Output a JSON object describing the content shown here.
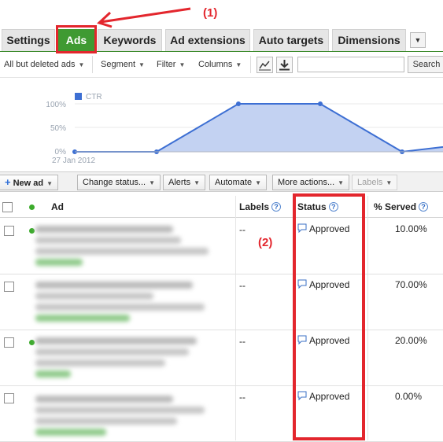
{
  "annotations": {
    "label1": "(1)",
    "label2": "(2)"
  },
  "tabs": [
    "Settings",
    "Ads",
    "Keywords",
    "Ad extensions",
    "Auto targets",
    "Dimensions"
  ],
  "toolbar": {
    "filter_scope": "All but deleted ads",
    "segment": "Segment",
    "filter": "Filter",
    "columns": "Columns",
    "search_value": "",
    "search_label": "Search"
  },
  "chart_data": {
    "type": "area",
    "legend": "CTR",
    "start_label": "27 Jan 2012",
    "yticks": [
      "100%",
      "50%",
      "0%"
    ],
    "ylim": [
      0,
      100
    ],
    "values": [
      0,
      0,
      100,
      100,
      0,
      20
    ],
    "color": "#3d6fd3"
  },
  "actions": {
    "new_ad": "New ad",
    "change_status": "Change status...",
    "alerts": "Alerts",
    "automate": "Automate",
    "more_actions": "More actions...",
    "labels": "Labels"
  },
  "table": {
    "headers": {
      "ad": "Ad",
      "labels": "Labels",
      "status": "Status",
      "served": "% Served"
    },
    "rows": [
      {
        "labels": "--",
        "status": "Approved",
        "served": "10.00%"
      },
      {
        "labels": "--",
        "status": "Approved",
        "served": "70.00%"
      },
      {
        "labels": "--",
        "status": "Approved",
        "served": "20.00%"
      },
      {
        "labels": "--",
        "status": "Approved",
        "served": "0.00%"
      }
    ]
  },
  "colors": {
    "tab_active": "#3f9a32",
    "annotation": "#e3262d",
    "status_dot": "#3cab2c"
  }
}
